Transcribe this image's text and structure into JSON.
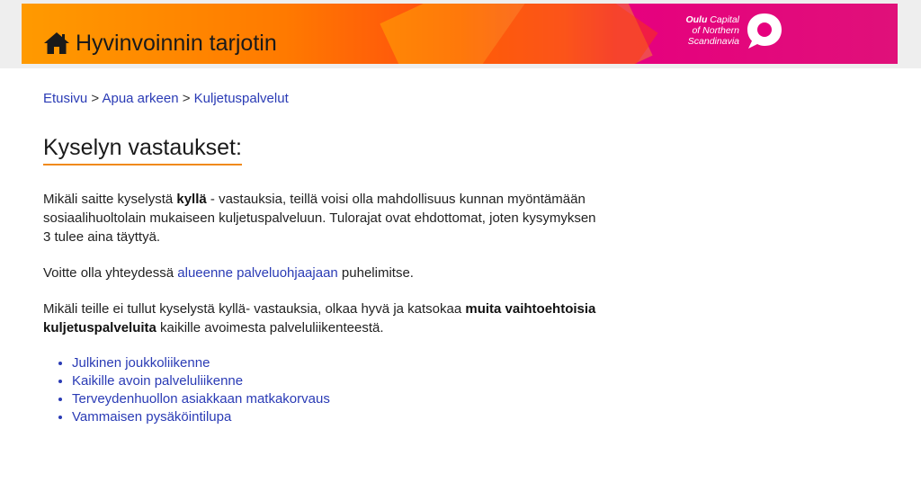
{
  "header": {
    "site_title": "Hyvinvoinnin tarjotin",
    "logo": {
      "line1_bold": "Oulu",
      "line1_rest": " Capital",
      "line2": "of Northern",
      "line3": "Scandinavia"
    }
  },
  "breadcrumb": {
    "items": [
      "Etusivu",
      "Apua arkeen",
      "Kuljetuspalvelut"
    ],
    "separator": ">"
  },
  "page": {
    "title": "Kyselyn vastaukset:"
  },
  "content": {
    "p1_before": "Mikäli saitte kyselystä ",
    "p1_bold": "kyllä",
    "p1_after": " - vastauksia, teillä voisi olla mahdollisuus kunnan myöntämään sosiaalihuoltolain mukaiseen kuljetuspalveluun. Tulorajat ovat ehdottomat, joten kysymyksen 3 tulee aina täyttyä.",
    "p2_before": "Voitte olla yhteydessä ",
    "p2_link": "alueenne palveluohjaajaan",
    "p2_after": " puhelimitse.",
    "p3_before": "Mikäli teille ei tullut kyselystä kyllä- vastauksia, olkaa hyvä ja katsokaa ",
    "p3_bold": "muita vaihtoehtoisia kuljetuspalveluita",
    "p3_after": " kaikille avoimesta palveluliikenteestä.",
    "links": [
      "Julkinen joukkoliikenne",
      "Kaikille avoin palveluliikenne",
      "Terveydenhuollon asiakkaan matkakorvaus",
      "Vammaisen pysäköintilupa"
    ]
  },
  "colors": {
    "link": "#2a3bb5",
    "title_underline": "#f08a1c",
    "banner_orange": "#ff9a00",
    "banner_magenta": "#e6007e"
  }
}
